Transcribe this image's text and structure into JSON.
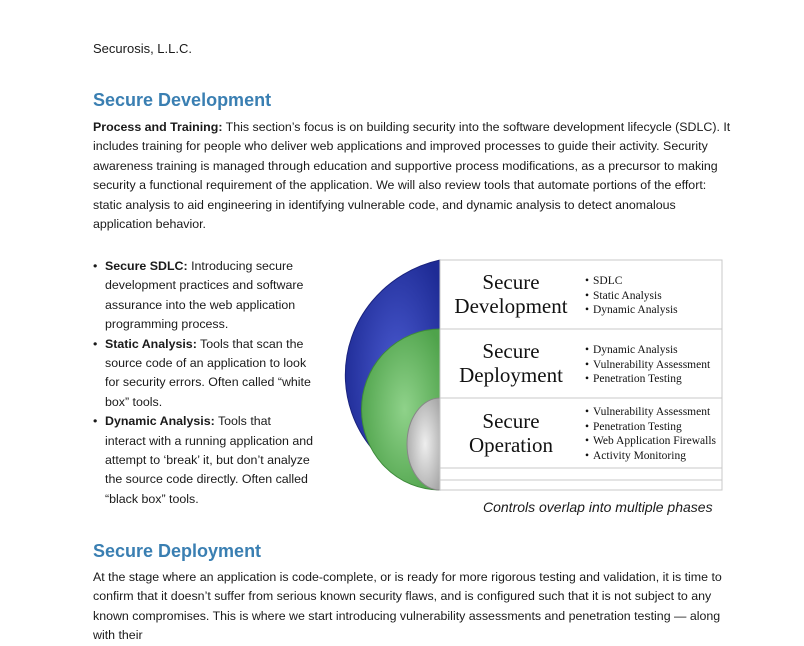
{
  "header": {
    "company": "Securosis, L.L.C."
  },
  "section1": {
    "title": "Secure Development",
    "lead": "Process and Training:",
    "body": " This section’s focus is on building security into the software development lifecycle (SDLC). It includes training for people who deliver web applications and improved processes to guide their activity. Security awareness training is managed through education and supportive process modifications, as a precursor to making security a functional requirement of the application. We will also review tools that automate portions of the effort: static analysis to aid engineering in identifying vulnerable code, and dynamic analysis to detect anomalous application behavior."
  },
  "bullets": [
    {
      "term": "Secure SDLC:",
      "text": " Introducing secure development practices and software assurance into the web application programming process."
    },
    {
      "term": "Static Analysis:",
      "text": " Tools that scan the source code of an application to look for security errors. Often called “white box” tools."
    },
    {
      "term": "Dynamic Analysis:",
      "text": " Tools that interact with a running application and attempt to ‘break’ it, but don’t analyze the source code directly. Often called “black box” tools."
    }
  ],
  "diagram": {
    "phases": [
      {
        "line1": "Secure",
        "line2": "Development",
        "items": [
          "SDLC",
          "Static Analysis",
          "Dynamic Analysis"
        ]
      },
      {
        "line1": "Secure",
        "line2": "Deployment",
        "items": [
          "Dynamic Analysis",
          "Vulnerability Assessment",
          "Penetration Testing"
        ]
      },
      {
        "line1": "Secure",
        "line2": "Operation",
        "items": [
          "Vulnerability Assessment",
          "Penetration Testing",
          "Web Application Firewalls",
          "Activity Monitoring"
        ]
      }
    ],
    "colors": {
      "development": "#2a39a8",
      "deployment": "#5fb35a",
      "operation": "#b7b7b7"
    },
    "caption": "Controls overlap into multiple phases"
  },
  "section2": {
    "title": "Secure Deployment",
    "body": "At the stage where an application is code-complete, or is ready for more rigorous testing and validation, it is time to confirm that it doesn’t suffer from serious known security flaws, and is configured such that it is not subject to any known compromises. This is where we start introducing vulnerability assessments and penetration testing — along with their"
  }
}
